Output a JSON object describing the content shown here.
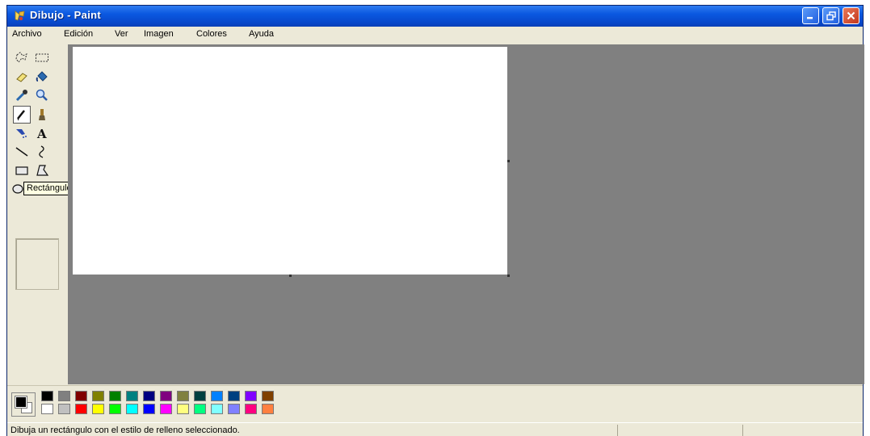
{
  "window": {
    "title": "Dibujo - Paint"
  },
  "menu": [
    "Archivo",
    "Edición",
    "Ver",
    "Imagen",
    "Colores",
    "Ayuda"
  ],
  "tools": [
    "free-select-icon",
    "rect-select-icon",
    "eraser-icon",
    "fill-bucket-icon",
    "color-picker-icon",
    "magnifier-icon",
    "pencil-icon",
    "brush-icon",
    "airbrush-icon",
    "text-icon",
    "line-icon",
    "curve-icon",
    "rectangle-icon",
    "polygon-icon",
    "ellipse-icon",
    "rounded-rect-icon"
  ],
  "selected_tool": "pencil-icon",
  "tooltip": "Rectángulo",
  "colors": {
    "foreground": "#000000",
    "background": "#ffffff",
    "palette_top": [
      "#000000",
      "#808080",
      "#800000",
      "#808000",
      "#008000",
      "#008080",
      "#000080",
      "#800080",
      "#808040",
      "#004040",
      "#0080ff",
      "#004080",
      "#8000ff",
      "#804000"
    ],
    "palette_bottom": [
      "#ffffff",
      "#c0c0c0",
      "#ff0000",
      "#ffff00",
      "#00ff00",
      "#00ffff",
      "#0000ff",
      "#ff00ff",
      "#ffff80",
      "#00ff80",
      "#80ffff",
      "#8080ff",
      "#ff0080",
      "#ff8040"
    ]
  },
  "status": {
    "text": "Dibuja un rectángulo con el estilo de relleno seleccionado."
  }
}
